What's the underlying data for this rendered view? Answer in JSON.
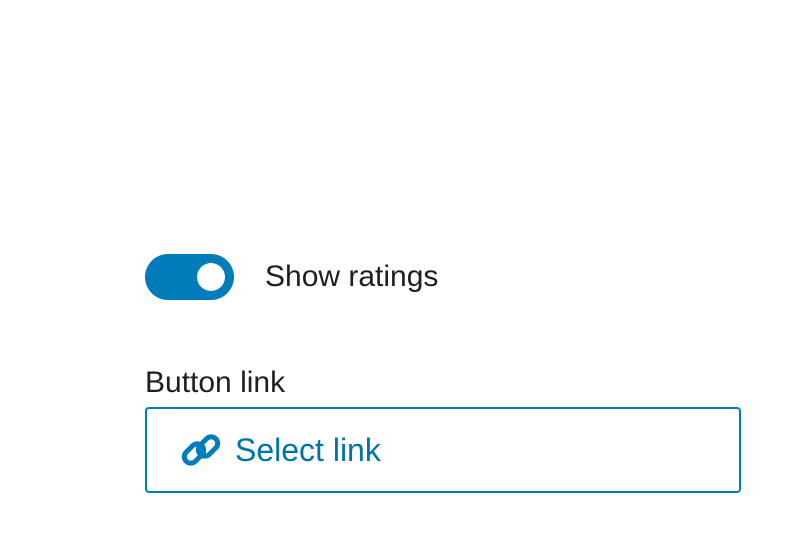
{
  "settings": {
    "show_ratings": {
      "label": "Show ratings",
      "checked": true
    },
    "button_link": {
      "label": "Button link",
      "button_label": "Select link",
      "icon": "link-icon"
    }
  },
  "colors": {
    "accent": "#007cba",
    "link_text": "#0073aa",
    "text": "#1e1e1e"
  }
}
